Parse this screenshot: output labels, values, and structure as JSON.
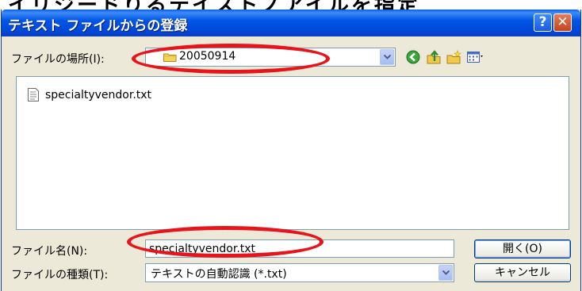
{
  "caption": {
    "text": "イリジードりるテイストノアイルを指定"
  },
  "window": {
    "title": "テキスト ファイルからの登録",
    "help_glyph": "?",
    "close_glyph": "✕"
  },
  "look_in": {
    "label": "ファイルの場所(I):",
    "value": "20050914"
  },
  "toolbar": {
    "icons": [
      "back-icon",
      "up-folder-icon",
      "new-folder-icon",
      "views-menu-icon"
    ]
  },
  "files": [
    {
      "name": "specialtyvendor.txt",
      "icon": "text-file-icon"
    }
  ],
  "file_name": {
    "label": "ファイル名(N):",
    "value": "specialtyvendor.txt"
  },
  "file_type": {
    "label": "ファイルの種類(T):",
    "value": "テキストの自動認識 (*.txt)"
  },
  "buttons": {
    "open": "開く(O)",
    "cancel": "キャンセル"
  },
  "colors": {
    "titlebar": "#0054e3",
    "window_bg": "#ece9d8",
    "annotation": "#e8141c"
  }
}
